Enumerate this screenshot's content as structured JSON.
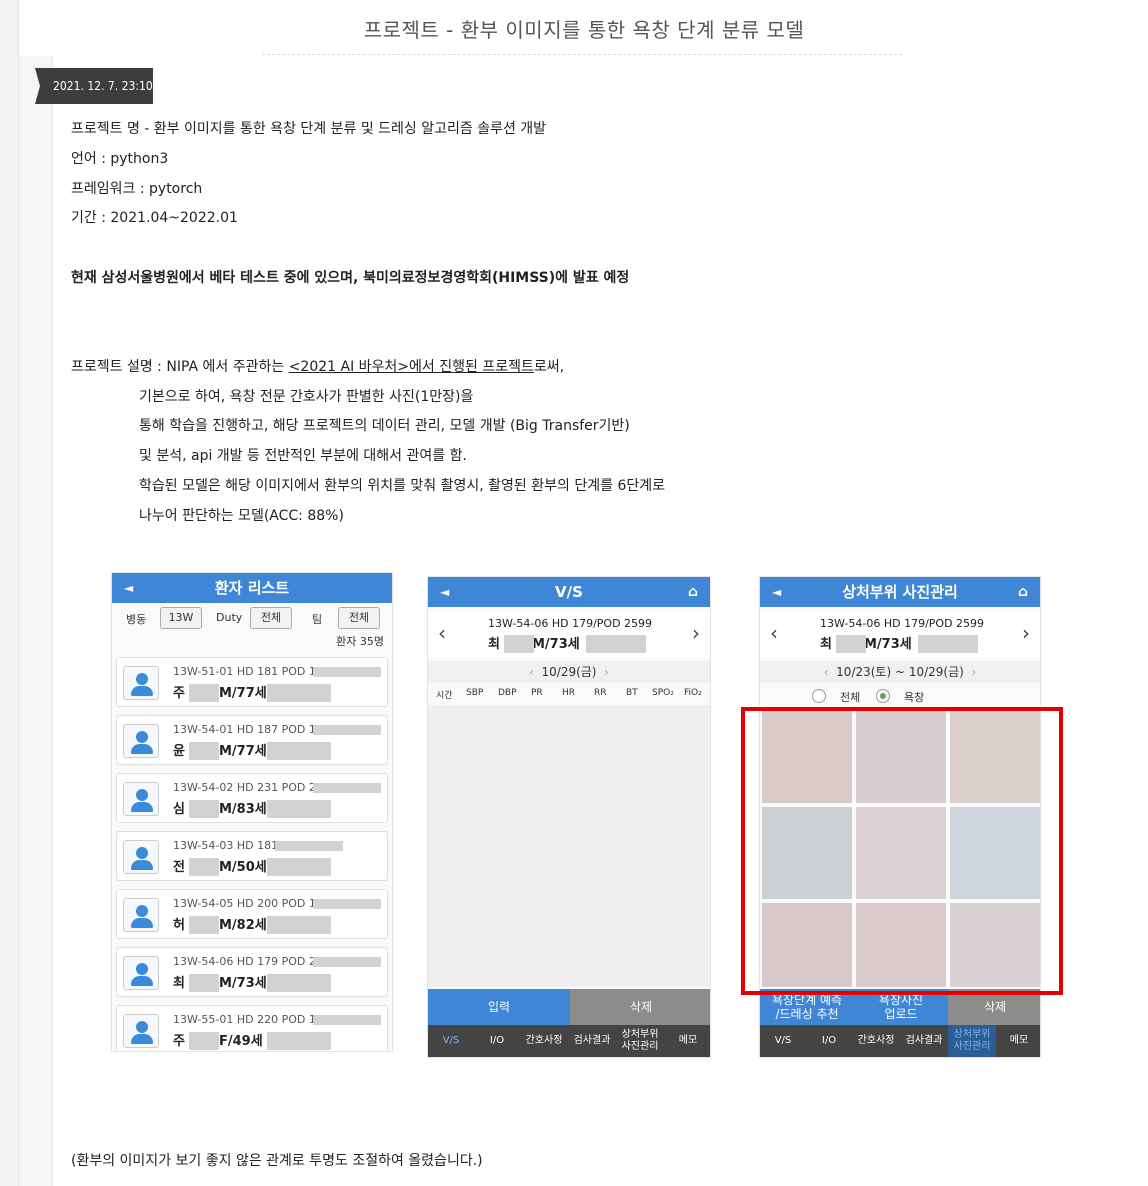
{
  "post": {
    "title": "프로젝트 - 환부 이미지를 통한 욕창 단계 분류 모델",
    "date": "2021. 12. 7. 23:10"
  },
  "info": {
    "project_name": "프로젝트 명 - 환부 이미지를 통한 욕창 단계 분류 및 드레싱 알고리즘 솔루션 개발",
    "language": "언어 : python3",
    "framework": "프레임워크 : pytorch",
    "period": "기간 :  2021.04~2022.01",
    "highlight": "현재 삼성서울병원에서 베타 테스트 중에 있으며, 북미의료정보경영학회(HIMSS)에 발표 예정"
  },
  "description": {
    "prefix": "프로젝트 설명 :  NIPA 에서 주관하는 ",
    "link": "<2021 AI 바우처>에서 진행된 프로젝트",
    "suffix": "로써,",
    "lines": [
      "기본으로 하여,  욕창 전문 간호사가 판별한  사진(1만장)을",
      "통해 학습을 진행하고, 해당 프로젝트의 데이터 관리, 모델 개발 (Big Transfer기반)",
      "및 분석, api 개발 등 전반적인 부분에 대해서 관여를 함.",
      "학습된 모델은 해당 이미지에서 환부의 위치를 맞춰 촬영시, 촬영된 환부의 단계를 6단계로",
      "나누어 판단하는 모델(ACC: 88%)"
    ]
  },
  "screen1": {
    "title": "환자 리스트",
    "back": "◄",
    "ward_label": "병동",
    "ward_value": "13W",
    "duty_label": "Duty",
    "duty_value": "전체",
    "team_label": "팀",
    "team_value": "전체",
    "count": "환자 35명",
    "patients": [
      {
        "line1": "13W-51-01 HD 181 POD 180",
        "initial": "주",
        "info": "M/77세"
      },
      {
        "line1": "13W-54-01 HD 187 POD 184",
        "initial": "윤",
        "info": "M/77세"
      },
      {
        "line1": "13W-54-02 HD 231 POD 228",
        "initial": "심",
        "info": "M/83세"
      },
      {
        "line1": "13W-54-03 HD 181",
        "initial": "전",
        "info": "M/50세"
      },
      {
        "line1": "13W-54-05 HD 200 POD 197",
        "initial": "허",
        "info": "M/82세"
      },
      {
        "line1": "13W-54-06 HD 179 POD 2599",
        "initial": "최",
        "info": "M/73세"
      },
      {
        "line1": "13W-55-01 HD 220 POD 198",
        "initial": "주",
        "info": "F/49세"
      }
    ]
  },
  "screen2": {
    "title": "V/S",
    "back": "◄",
    "home": "⌂",
    "patient_line1": "13W-54-06  HD 179/POD 2599",
    "patient_initial": "최",
    "patient_info": "M/73세",
    "date": "10/29(금)",
    "columns": [
      "시간",
      "SBP",
      "DBP",
      "PR",
      "HR",
      "RR",
      "BT",
      "SPO₂",
      "FiO₂"
    ],
    "buttons": [
      "입력",
      "삭제"
    ],
    "tabs": [
      "V/S",
      "I/O",
      "간호사정",
      "검사결과",
      "상처부위\n사진관리",
      "메모"
    ]
  },
  "screen3": {
    "title": "상처부위 사진관리",
    "back": "◄",
    "home": "⌂",
    "patient_line1": "13W-54-06  HD 179/POD 2599",
    "patient_initial": "최",
    "patient_info": "M/73세",
    "date": "10/23(토) ~ 10/29(금)",
    "radio_all": "전체",
    "radio_bedsore": "욕창",
    "buttons": [
      "욕창단계 예측\n/드레싱 추천",
      "욕창사진\n업로드",
      "삭제"
    ],
    "tabs": [
      "V/S",
      "I/O",
      "간호사정",
      "검사결과",
      "상처부위\n사진관리",
      "메모"
    ]
  },
  "caption": "(환부의 이미지가 보기 좋지 않은 관계로 투명도 조절하여 올렸습니다.)",
  "colors": {
    "header_blue": "#3f86d6",
    "highlight_red": "#e40000",
    "date_badge": "#3d3d3d"
  }
}
